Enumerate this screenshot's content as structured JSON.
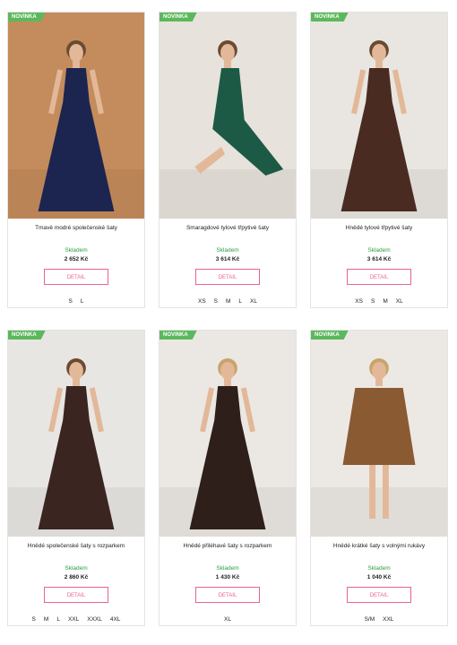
{
  "badge_label": "NOVINKA",
  "detail_label": "DETAIL",
  "colors": {
    "badge": "#5cb85c",
    "stock": "#2e9e3e",
    "detail_border": "#e8648f"
  },
  "products": [
    {
      "title": "Tmavě modré společenské šaty",
      "stock": "Skladem",
      "price": "2 652 Kč",
      "sizes": [
        "S",
        "L"
      ],
      "dress_color": "#1c2550",
      "bg_color": "#c48c5c"
    },
    {
      "title": "Smaragdové tylové třpytivé šaty",
      "stock": "Skladem",
      "price": "3 614 Kč",
      "sizes": [
        "XS",
        "S",
        "M",
        "L",
        "XL"
      ],
      "dress_color": "#1d5a45",
      "bg_color": "#e7e2dc"
    },
    {
      "title": "Hnědé tylové třpytivé šaty",
      "stock": "Skladem",
      "price": "3 614 Kč",
      "sizes": [
        "XS",
        "S",
        "M",
        "XL"
      ],
      "dress_color": "#4a2b22",
      "bg_color": "#e9e6e1"
    },
    {
      "title": "Hnědé společenské šaty s rozparkem",
      "stock": "Skladem",
      "price": "2 860 Kč",
      "sizes": [
        "S",
        "M",
        "L",
        "XXL",
        "XXXL",
        "4XL"
      ],
      "dress_color": "#3a2520",
      "bg_color": "#e8e6e3"
    },
    {
      "title": "Hnědé přiléhavé šaty s rozparkem",
      "stock": "Skladem",
      "price": "1 430 Kč",
      "sizes": [
        "XL"
      ],
      "dress_color": "#2e1f1a",
      "bg_color": "#ebe8e4"
    },
    {
      "title": "Hnědé krátké šaty s volnými rukávy",
      "stock": "Skladem",
      "price": "1 040 Kč",
      "sizes": [
        "S/M",
        "XXL"
      ],
      "dress_color": "#8a5a33",
      "bg_color": "#ece9e5"
    }
  ]
}
